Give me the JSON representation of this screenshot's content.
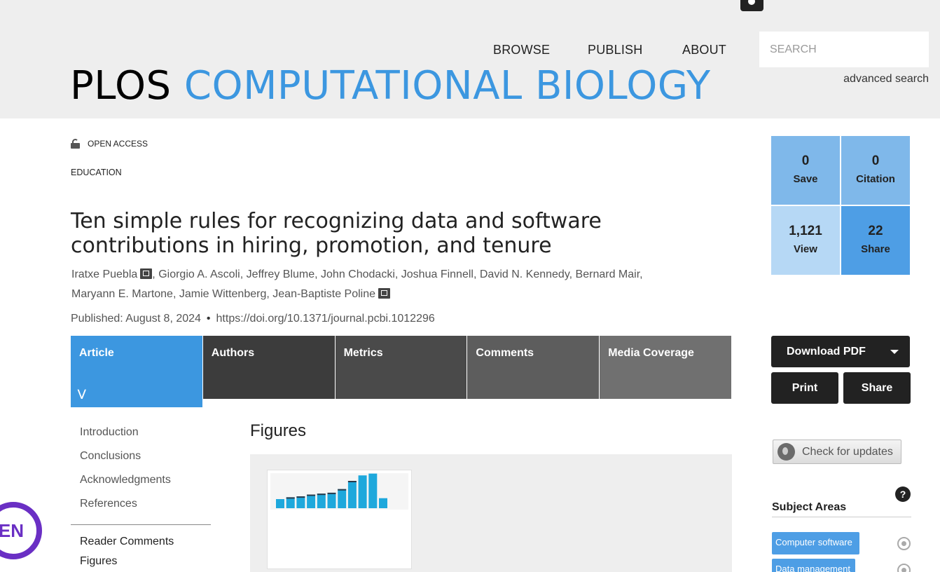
{
  "header": {
    "nav": [
      "BROWSE",
      "PUBLISH",
      "ABOUT"
    ],
    "search_placeholder": "SEARCH",
    "advanced_search": "advanced search",
    "journal_plos": "PLOS",
    "journal_name": "COMPUTATIONAL BIOLOGY"
  },
  "article": {
    "access": "OPEN ACCESS",
    "category": "EDUCATION",
    "title": "Ten simple rules for recognizing data and software contributions in hiring, promotion, and tenure",
    "authors": [
      "Iratxe Puebla",
      "Giorgio A. Ascoli",
      "Jeffrey Blume",
      "John Chodacki",
      "Joshua Finnell",
      "David N. Kennedy",
      "Bernard Mair",
      "Maryann E. Martone",
      "Jamie Wittenberg",
      "Jean-Baptiste Poline"
    ],
    "published": "Published: August 8, 2024",
    "doi": "https://doi.org/10.1371/journal.pcbi.1012296"
  },
  "tabs": [
    "Article",
    "Authors",
    "Metrics",
    "Comments",
    "Media Coverage"
  ],
  "leftnav": {
    "sections": [
      "Introduction",
      "Conclusions",
      "Acknowledgments",
      "References"
    ],
    "extras": [
      "Reader Comments",
      "Figures"
    ]
  },
  "figures": {
    "title": "Figures",
    "thumb_chart": {
      "type": "bar",
      "values": [
        10,
        12,
        13,
        15,
        16,
        17,
        21,
        30,
        36,
        38,
        11
      ],
      "colors": {
        "bar": "#1ea8dc",
        "cap": "#2a3a4a"
      }
    }
  },
  "metrics": {
    "save": {
      "num": "0",
      "label": "Save"
    },
    "citation": {
      "num": "0",
      "label": "Citation"
    },
    "view": {
      "num": "1,121",
      "label": "View"
    },
    "share": {
      "num": "22",
      "label": "Share"
    }
  },
  "actions": {
    "download": "Download PDF",
    "print": "Print",
    "share": "Share",
    "check_updates": "Check for updates"
  },
  "subject_areas": {
    "title": "Subject Areas",
    "help": "?",
    "tags": [
      "Computer software",
      "Data management"
    ]
  },
  "lang_badge": "EN",
  "colors": {
    "accent": "#3c97e0",
    "header_bg": "#eeeeee",
    "badge": "#6a2fc4"
  }
}
